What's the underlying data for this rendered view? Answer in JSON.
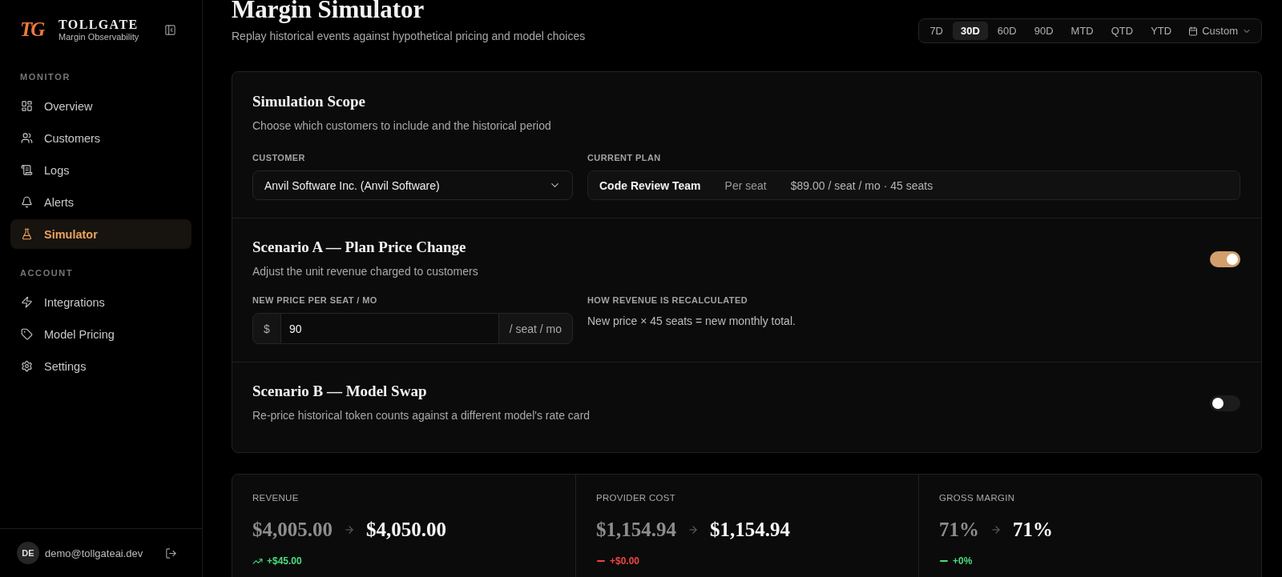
{
  "sidebar": {
    "brand": {
      "mark": "TG",
      "name": "TOLLGATE",
      "tagline": "Margin Observability"
    },
    "sections": [
      {
        "title": "MONITOR",
        "items": [
          {
            "label": "Overview",
            "selected": false
          },
          {
            "label": "Customers",
            "selected": false
          },
          {
            "label": "Logs",
            "selected": false
          },
          {
            "label": "Alerts",
            "selected": false
          },
          {
            "label": "Simulator",
            "selected": true
          }
        ]
      },
      {
        "title": "ACCOUNT",
        "items": [
          {
            "label": "Integrations",
            "selected": false
          },
          {
            "label": "Model Pricing",
            "selected": false
          },
          {
            "label": "Settings",
            "selected": false
          }
        ]
      }
    ],
    "user": {
      "initials": "DE",
      "email": "demo@tollgateai.dev"
    }
  },
  "header": {
    "title": "Margin Simulator",
    "subtitle": "Replay historical events against hypothetical pricing and model choices"
  },
  "date_range": {
    "options": [
      {
        "label": "7D",
        "selected": false
      },
      {
        "label": "30D",
        "selected": true
      },
      {
        "label": "60D",
        "selected": false
      },
      {
        "label": "90D",
        "selected": false
      },
      {
        "label": "MTD",
        "selected": false
      },
      {
        "label": "QTD",
        "selected": false
      },
      {
        "label": "YTD",
        "selected": false
      }
    ],
    "custom": {
      "label": "Custom",
      "selected": false
    }
  },
  "scope": {
    "title": "Simulation Scope",
    "description": "Choose which customers to include and the historical period",
    "customer": {
      "label": "CUSTOMER",
      "value": "Anvil Software Inc. (Anvil Software)"
    },
    "current_plan": {
      "label": "CURRENT PLAN",
      "name": "Code Review Team",
      "billing": "Per seat",
      "price": "$89.00 / seat / mo · 45 seats"
    }
  },
  "scenarios": [
    {
      "title": "Scenario A — Plan Price Change",
      "description": "Adjust the unit revenue charged to customers",
      "on": true,
      "price_input": {
        "label": "NEW PRICE PER SEAT / MO",
        "prefix": "$",
        "value": "90",
        "suffix": "/ seat / mo"
      },
      "explanation": {
        "label": "HOW REVENUE IS RECALCULATED",
        "text": "New price × 45 seats = new monthly total."
      }
    },
    {
      "title": "Scenario B — Model Swap",
      "description": "Re-price historical token counts against a different model's rate card",
      "on": false
    }
  ],
  "metrics": [
    {
      "label": "REVENUE",
      "before": "$4,005.00",
      "after": "$4,050.00",
      "delta": "+$45.00",
      "kind": "up",
      "color": "#4ade80"
    },
    {
      "label": "PROVIDER COST",
      "before": "$1,154.94",
      "after": "$1,154.94",
      "delta": "+$0.00",
      "kind": "flat",
      "color": "#ef4444"
    },
    {
      "label": "GROSS MARGIN",
      "before": "71%",
      "after": "71%",
      "delta": "+0%",
      "kind": "flat",
      "color": "#4ade80"
    }
  ]
}
